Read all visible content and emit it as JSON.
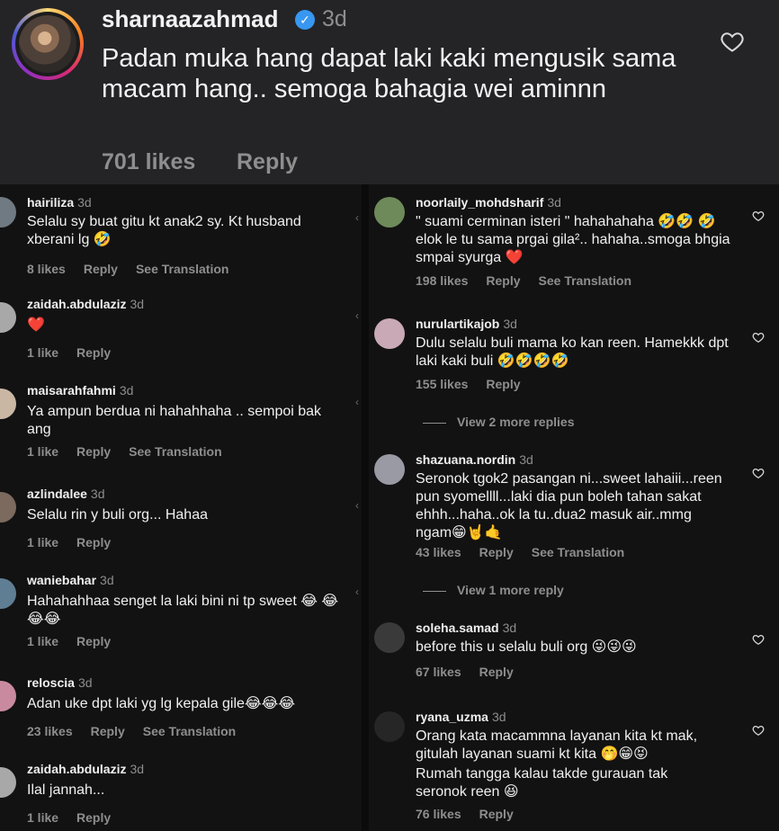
{
  "main_comment": {
    "username": "sharnaazahmad",
    "time": "3d",
    "text": "Padan muka hang dapat laki kaki mengusik sama macam hang.. semoga bahagia wei aminnn",
    "likes": "701 likes",
    "reply": "Reply"
  },
  "left_comments": [
    {
      "user": "hairiliza",
      "time": "3d",
      "text": "Selalu sy buat gitu kt anak2 sy. Kt husband xberani lg 🤣",
      "likes": "8 likes",
      "reply": "Reply",
      "translate": "See Translation"
    },
    {
      "user": "zaidah.abdulaziz",
      "time": "3d",
      "text": "❤️",
      "likes": "1 like",
      "reply": "Reply",
      "translate": ""
    },
    {
      "user": "maisarahfahmi",
      "time": "3d",
      "text": "Ya ampun berdua ni hahahhaha .. sempoi bak ang",
      "likes": "1 like",
      "reply": "Reply",
      "translate": "See Translation"
    },
    {
      "user": "azlindalee",
      "time": "3d",
      "text": "Selalu rin y buli org... Hahaa",
      "likes": "1 like",
      "reply": "Reply",
      "translate": ""
    },
    {
      "user": "waniebahar",
      "time": "3d",
      "text": "Hahahahhaa senget la laki bini ni tp sweet 😂 😂😂😂",
      "likes": "1 like",
      "reply": "Reply",
      "translate": ""
    },
    {
      "user": "reloscia",
      "time": "3d",
      "text": "Adan uke dpt laki yg lg kepala gile😂😂😂",
      "likes": "23 likes",
      "reply": "Reply",
      "translate": "See Translation"
    },
    {
      "user": "zaidah.abdulaziz",
      "time": "3d",
      "text": "Ilal jannah...",
      "likes": "1 like",
      "reply": "Reply",
      "translate": ""
    }
  ],
  "right_comments": [
    {
      "user": "noorlaily_mohdsharif",
      "time": "3d",
      "text": "\" suami cerminan isteri \" hahahahaha 🤣🤣 🤣 elok le tu sama prgai gila².. hahaha..smoga bhgia smpai syurga ❤️",
      "likes": "198 likes",
      "reply": "Reply",
      "translate": "See Translation"
    },
    {
      "user": "nurulartikajob",
      "time": "3d",
      "text": "Dulu selalu buli mama ko kan reen. Hamekkk dpt laki kaki buli 🤣🤣🤣🤣",
      "likes": "155 likes",
      "reply": "Reply",
      "translate": ""
    },
    {
      "user": "shazuana.nordin",
      "time": "3d",
      "text": "Seronok tgok2 pasangan ni...sweet lahaiii...reen pun syomellll...laki dia pun boleh tahan sakat ehhh...haha..ok la tu..dua2 masuk air..mmg ngam😁🤘🤙",
      "likes": "43 likes",
      "reply": "Reply",
      "translate": "See Translation"
    },
    {
      "user": "soleha.samad",
      "time": "3d",
      "text": "before this u selalu buli org 😜😜😜",
      "likes": "67 likes",
      "reply": "Reply",
      "translate": ""
    },
    {
      "user": "ryana_uzma",
      "time": "3d",
      "text": "Orang kata macammna layanan kita kt mak, gitulah layanan suami kt kita 🤭😁😝",
      "text2": "Rumah tangga kalau takde gurauan tak seronok reen 😆",
      "likes": "76 likes",
      "reply": "Reply",
      "translate": ""
    }
  ],
  "view_more": [
    "View 2 more replies",
    "View 1 more reply"
  ],
  "icons": {
    "heart": "heart-outline-icon",
    "verified": "verified-badge-icon",
    "chevron": "chevron-left-icon"
  },
  "colors": {
    "top_bg": "#242427",
    "bg": "#121212",
    "muted": "#8e8e8e",
    "verified": "#3897f0",
    "heart": "#e0245e"
  }
}
